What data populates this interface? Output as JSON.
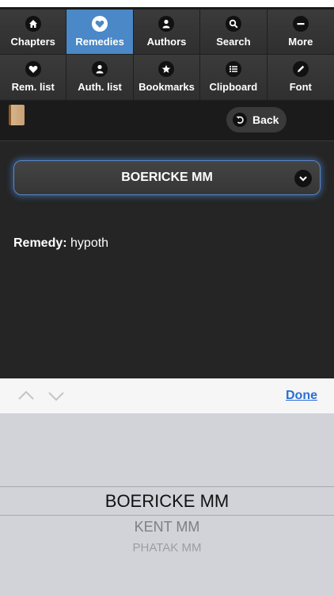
{
  "nav": [
    {
      "label": "Chapters",
      "icon": "home-icon",
      "active": false
    },
    {
      "label": "Remedies",
      "icon": "heart-icon",
      "active": true
    },
    {
      "label": "Authors",
      "icon": "user-icon",
      "active": false
    },
    {
      "label": "Search",
      "icon": "search-icon",
      "active": false
    },
    {
      "label": "More",
      "icon": "minus-icon",
      "active": false
    },
    {
      "label": "Rem. list",
      "icon": "heart-icon",
      "active": false
    },
    {
      "label": "Auth. list",
      "icon": "user-icon",
      "active": false
    },
    {
      "label": "Bookmarks",
      "icon": "star-icon",
      "active": false
    },
    {
      "label": "Clipboard",
      "icon": "list-icon",
      "active": false
    },
    {
      "label": "Font",
      "icon": "pencil-icon",
      "active": false
    }
  ],
  "header": {
    "back_label": "Back",
    "logo_icon": "book-icon"
  },
  "content": {
    "select_value": "BOERICKE MM",
    "remedy_label": "Remedy:",
    "remedy_value": "hypoth"
  },
  "keyboard_bar": {
    "done_label": "Done"
  },
  "picker": {
    "options": [
      "BOERICKE MM",
      "KENT MM",
      "PHATAK MM"
    ],
    "selected": "BOERICKE MM"
  },
  "colors": {
    "active_tab": "#4a88c7",
    "link": "#2a6fd6"
  }
}
